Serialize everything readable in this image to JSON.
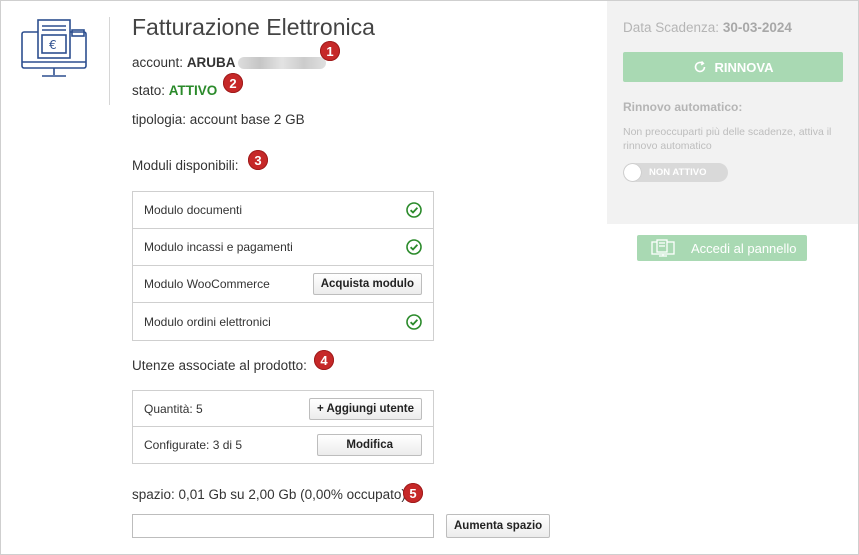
{
  "header": {
    "title": "Fatturazione Elettronica",
    "account_label": "account:",
    "account_value": "ARUBA",
    "status_label": "stato:",
    "status_value": "ATTIVO",
    "type_text": "tipologia: account base 2 GB"
  },
  "badges": [
    "1",
    "2",
    "3",
    "4",
    "5"
  ],
  "modules": {
    "heading": "Moduli disponibili:",
    "items": [
      {
        "label": "Modulo documenti",
        "state": "active"
      },
      {
        "label": "Modulo incassi e pagamenti",
        "state": "active"
      },
      {
        "label": "Modulo WooCommerce",
        "button": "Acquista modulo"
      },
      {
        "label": "Modulo ordini elettronici",
        "state": "active"
      }
    ]
  },
  "users": {
    "heading": "Utenze associate al prodotto:",
    "quantity": "Quantità: 5",
    "add_button": "+ Aggiungi utente",
    "configured": "Configurate: 3 di 5",
    "edit_button": "Modifica"
  },
  "storage": {
    "text": "spazio: 0,01 Gb su 2,00 Gb (0,00% occupato)",
    "input_value": "",
    "button": "Aumenta spazio"
  },
  "sidebar": {
    "expiry_label": "Data Scadenza:",
    "expiry_value": "30-03-2024",
    "renew_button": "RINNOVA",
    "auto_label": "Rinnovo automatico:",
    "auto_text": "Non preoccuparti più delle scadenze, attiva il rinnovo automatico",
    "toggle_label": "NON ATTIVO",
    "panel_button": "Accedi al pannello"
  },
  "colors": {
    "accent_green": "#a9d9b3",
    "status_green": "#2a8a2a",
    "badge_red": "#c62828",
    "logo_blue": "#2d4f8f"
  },
  "icons": [
    "invoice-monitor-icon",
    "check-circle-icon",
    "refresh-icon",
    "panel-icon"
  ]
}
